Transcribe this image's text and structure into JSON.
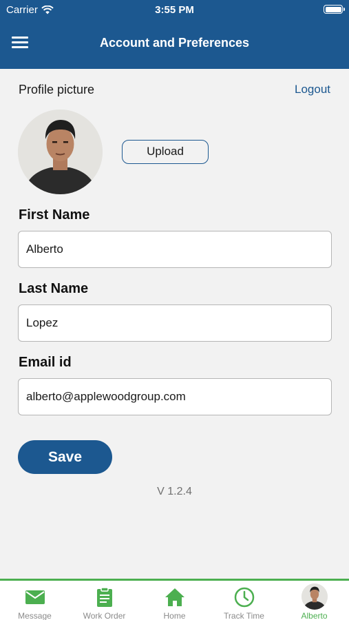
{
  "status_bar": {
    "carrier": "Carrier",
    "time": "3:55 PM"
  },
  "header": {
    "title": "Account and Preferences"
  },
  "profile": {
    "label": "Profile picture",
    "logout_label": "Logout",
    "upload_label": "Upload"
  },
  "form": {
    "first_name": {
      "label": "First Name",
      "value": "Alberto"
    },
    "last_name": {
      "label": "Last Name",
      "value": "Lopez"
    },
    "email": {
      "label": "Email id",
      "value": "alberto@applewoodgroup.com"
    }
  },
  "save_label": "Save",
  "version": "V 1.2.4",
  "tabs": [
    {
      "label": "Message",
      "icon": "envelope-icon"
    },
    {
      "label": "Work Order",
      "icon": "clipboard-icon"
    },
    {
      "label": "Home",
      "icon": "home-icon"
    },
    {
      "label": "Track Time",
      "icon": "clock-icon"
    },
    {
      "label": "Alberto",
      "icon": "avatar"
    }
  ],
  "colors": {
    "header": "#1c5890",
    "accent_green": "#4caf50",
    "tab_inactive": "#8a8a8a"
  }
}
